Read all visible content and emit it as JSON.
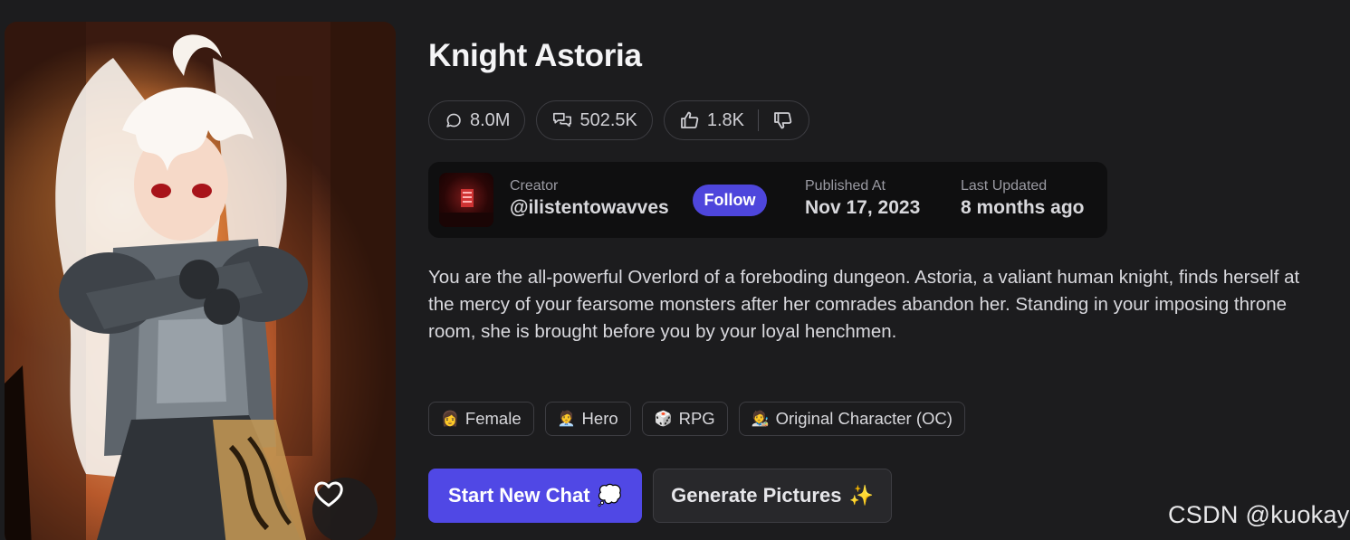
{
  "character": {
    "name": "Knight Astoria",
    "description": "You are the all-powerful Overlord of a foreboding dungeon. Astoria, a valiant human knight, finds herself at the mercy of your fearsome monsters after her comrades abandon her. Standing in your imposing throne room, she is brought before you by your loyal henchmen."
  },
  "stats": {
    "messages": "8.0M",
    "chats": "502.5K",
    "likes": "1.8K"
  },
  "creator": {
    "label": "Creator",
    "handle": "@ilistentowavves",
    "follow_label": "Follow",
    "published_label": "Published At",
    "published_value": "Nov 17, 2023",
    "updated_label": "Last Updated",
    "updated_value": "8 months ago"
  },
  "tags": [
    {
      "emoji": "👩",
      "label": "Female"
    },
    {
      "emoji": "🧑‍💼",
      "label": "Hero"
    },
    {
      "emoji": "🎲",
      "label": "RPG"
    },
    {
      "emoji": "🧑‍🎨",
      "label": "Original Character (OC)"
    }
  ],
  "actions": {
    "start_chat_label": "Start New Chat",
    "start_chat_emoji": "💭",
    "generate_label": "Generate Pictures",
    "generate_emoji": "✨"
  },
  "watermark": "CSDN @kuokay",
  "icons": {
    "messages": "message-circle-icon",
    "chats": "chats-icon",
    "like": "thumbs-up-icon",
    "dislike": "thumbs-down-icon",
    "favorite": "heart-icon"
  },
  "colors": {
    "background": "#1c1c1e",
    "accent": "#5048e5",
    "panel": "#0f0f10",
    "border": "#3d3d42"
  }
}
